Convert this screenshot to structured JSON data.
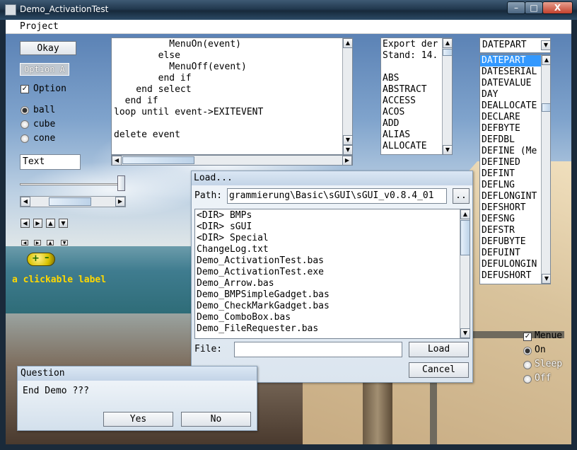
{
  "window": {
    "title": "Demo_ActivationTest",
    "minimize": "–",
    "maximize": "□",
    "close": "X"
  },
  "menu": {
    "project": "Project"
  },
  "left": {
    "okay_button": "Okay",
    "option_button": "Option A",
    "option_checkbox": {
      "label": "Option",
      "checked": true,
      "mark": "✓"
    },
    "radios": [
      {
        "label": "ball",
        "selected": true
      },
      {
        "label": "cube",
        "selected": false
      },
      {
        "label": "cone",
        "selected": false
      }
    ],
    "text_input": "Text",
    "clickable_label": "a clickable label",
    "plus_minus": {
      "plus": "+",
      "minus": "–"
    }
  },
  "code_editor": {
    "lines": [
      "          MenuOn(event)",
      "        else",
      "          MenuOff(event)",
      "        end if",
      "    end select",
      "  end if",
      "loop until event->EXITEVENT",
      "",
      "delete event"
    ]
  },
  "export_list": {
    "lines": [
      "Export der",
      "Stand: 14.",
      "",
      "ABS",
      "ABSTRACT",
      "ACCESS",
      "ACOS",
      "ADD",
      "ALIAS",
      "ALLOCATE"
    ]
  },
  "keyword_combo": {
    "selected": "DATEPART",
    "items": [
      "DATEPART",
      "DATESERIAL",
      "DATEVALUE",
      "DAY",
      "DEALLOCATE",
      "DECLARE",
      "DEFBYTE",
      "DEFDBL",
      "DEFINE (Me",
      "DEFINED",
      "DEFINT",
      "DEFLNG",
      "DEFLONGINT",
      "DEFSHORT",
      "DEFSNG",
      "DEFSTR",
      "DEFUBYTE",
      "DEFUINT",
      "DEFULONGIN",
      "DEFUSHORT"
    ]
  },
  "load_dialog": {
    "title": "Load...",
    "path_label": "Path:",
    "path_value": "grammierung\\Basic\\sGUI\\sGUI_v0.8.4_01",
    "path_button": "..",
    "files": [
      "<DIR> BMPs",
      "<DIR> sGUI",
      "<DIR> Special",
      "ChangeLog.txt",
      "Demo_ActivationTest.bas",
      "Demo_ActivationTest.exe",
      "Demo_Arrow.bas",
      "Demo_BMPSimpleGadget.bas",
      "Demo_CheckMarkGadget.bas",
      "Demo_ComboBox.bas",
      "Demo_FileRequester.bas"
    ],
    "file_label": "File:",
    "file_value": "",
    "load_button": "Load",
    "cancel_button": "Cancel"
  },
  "question_dialog": {
    "title": "Question",
    "message": "End Demo ???",
    "yes_button": "Yes",
    "no_button": "No"
  },
  "right_controls": {
    "menue_checkbox": {
      "label": "Menue",
      "checked": true,
      "mark": "✓"
    },
    "radios": [
      {
        "label": "On",
        "selected": true
      },
      {
        "label": "Sleep",
        "selected": false
      },
      {
        "label": "Off",
        "selected": false
      }
    ]
  },
  "icons": {
    "arrow_up": "▲",
    "arrow_down": "▼",
    "arrow_left": "◀",
    "arrow_right": "▶"
  }
}
